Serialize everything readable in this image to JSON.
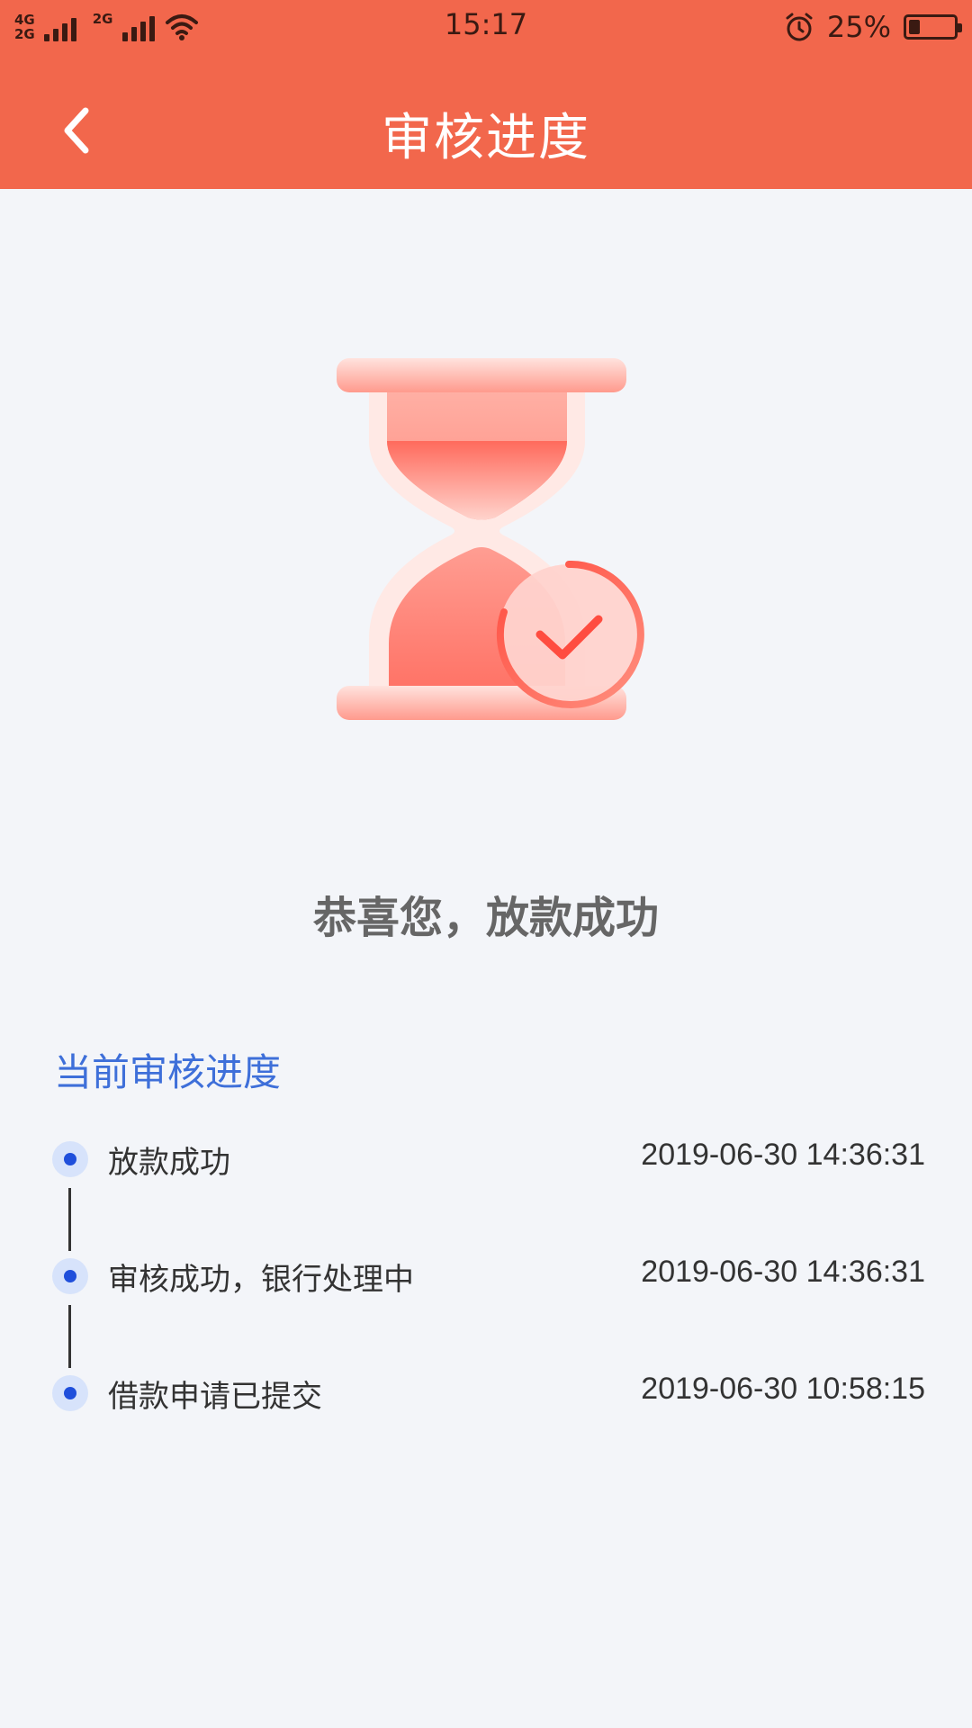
{
  "status_bar": {
    "network_1": "4G",
    "network_2": "2G",
    "network_3": "2G",
    "time": "15:17",
    "battery_percent": "25%",
    "battery_level": 0.25
  },
  "nav": {
    "title": "审核进度"
  },
  "result": {
    "message": "恭喜您，放款成功"
  },
  "progress": {
    "title": "当前审核进度",
    "items": [
      {
        "label": "放款成功",
        "time": "2019-06-30 14:36:31"
      },
      {
        "label": "审核成功，银行处理中",
        "time": "2019-06-30 14:36:31"
      },
      {
        "label": "借款申请已提交",
        "time": "2019-06-30 10:58:15"
      }
    ]
  },
  "colors": {
    "header": "#f2674c",
    "accent_blue": "#3e6fd9",
    "dot_blue": "#1f4fdb",
    "background": "#f3f5f9"
  },
  "icons": {
    "back": "chevron-left-icon",
    "illustration": "hourglass-check-icon"
  }
}
